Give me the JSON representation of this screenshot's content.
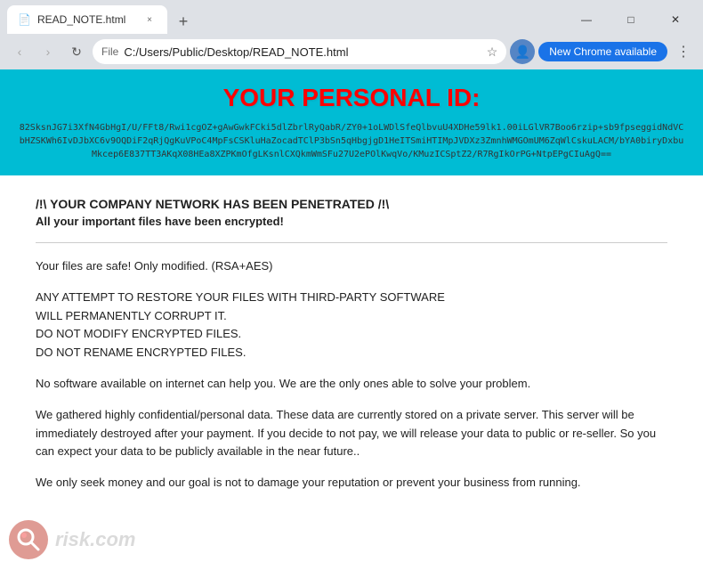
{
  "browser": {
    "tab": {
      "favicon": "📄",
      "title": "READ_NOTE.html",
      "close_label": "×"
    },
    "new_tab_label": "+",
    "window_controls": {
      "minimize": "—",
      "maximize": "□",
      "close": "✕"
    },
    "nav": {
      "back": "‹",
      "forward": "›",
      "refresh": "↻"
    },
    "address": {
      "protocol": "File",
      "url": "C:/Users/Public/Desktop/READ_NOTE.html"
    },
    "star": "☆",
    "profile_icon": "👤",
    "update_button": "New Chrome available",
    "menu": "⋮"
  },
  "page": {
    "id_banner": {
      "title": "YOUR PERSONAL ID:",
      "id_value": "82SksnJG7i3XfN4GbHgI/U/FFt8/Rwi1cgOZ+gAwGwkFCki5dlZbrlRyQabR/ZY0+1oLWDlSfeQlbvuU4XDHe59lk1.00iLGlVR7Boo6rzip+sb9fpseggidNdVCbHZSKWh6IvDJbXC6v9OQDiF2qRjQgKuVPoC4MpFsCSKluHaZocadTClP3bSn5qHbgjgD1HeITSmiHTIMpJVDXz3ZmnhWMGOmUM6ZqWlCskuLACM/bYA0biryDxbuMkcep6E837TT3AKqX08HEa8XZPKmOfgLKsnlCXQkmWmSFu27U2ePOlKwqVo/KMuzICSptZ2/R7RgIkOrPG+NtpEPgCIuAgQ=="
    },
    "heading": "/!\\ YOUR COMPANY NETWORK HAS BEEN PENETRATED /!\\",
    "subheading": "All your important files have been encrypted!",
    "paragraphs": [
      "Your files are safe! Only modified. (RSA+AES)",
      "ANY ATTEMPT TO RESTORE YOUR FILES WITH THIRD-PARTY SOFTWARE\nWILL PERMANENTLY CORRUPT IT.\nDO NOT MODIFY ENCRYPTED FILES.\nDO NOT RENAME ENCRYPTED FILES.",
      "No software available on internet can help you. We are the only ones able to solve your problem.",
      "We gathered highly confidential/personal data. These data are currently stored on a private server. This server will be immediately destroyed after your payment. If you decide to not pay, we will release your data to public or re-seller. So you can expect your data to be publicly available in the near future..",
      "We only seek money and our goal is not to damage your reputation or prevent your business from running."
    ]
  }
}
